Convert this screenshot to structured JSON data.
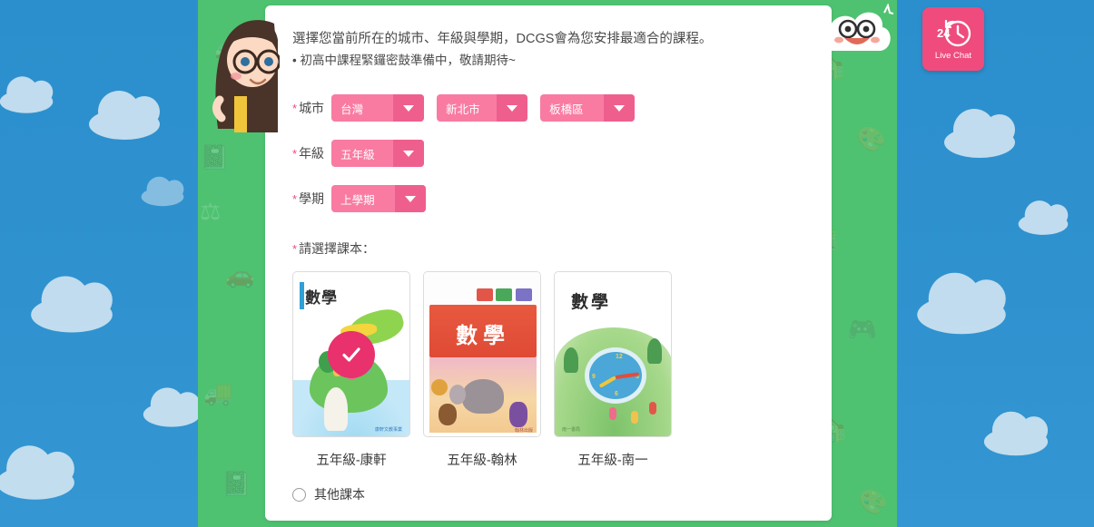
{
  "intro": {
    "line1": "選擇您當前所在的城市、年級與學期，DCGS會為您安排最適合的課程。",
    "line2": "• 初高中課程緊鑼密鼓準備中，敬請期待~"
  },
  "form": {
    "city": {
      "label": "城市",
      "required_mark": "*",
      "selects": [
        {
          "name": "country",
          "value": "台灣"
        },
        {
          "name": "city",
          "value": "新北市"
        },
        {
          "name": "district",
          "value": "板橋區"
        }
      ]
    },
    "grade": {
      "label": "年級",
      "required_mark": "*",
      "selects": [
        {
          "name": "grade",
          "value": "五年級"
        }
      ]
    },
    "term": {
      "label": "學期",
      "required_mark": "*",
      "selects": [
        {
          "name": "term",
          "value": "上學期"
        }
      ]
    }
  },
  "textbooks": {
    "label": "請選擇課本：",
    "required_mark": "*",
    "items": [
      {
        "caption": "五年級-康軒",
        "cover_title": "數學",
        "publisher_mark": "康軒文教事業",
        "selected": true
      },
      {
        "caption": "五年級-翰林",
        "cover_title": "數學",
        "publisher_mark": "翰林出版",
        "selected": false
      },
      {
        "caption": "五年級-南一",
        "cover_title": "數學",
        "publisher_mark": "南一書局",
        "selected": false
      }
    ],
    "other_option": {
      "label": "其他課本",
      "checked": false
    }
  },
  "live_chat": {
    "label": "Live Chat",
    "badge_number": "24"
  },
  "colors": {
    "sky_blue": "#2e90cc",
    "band_green": "#4ec271",
    "card_white": "#ffffff",
    "select_pink": "#f97ba2",
    "select_arrow_pink": "#ef5f8e",
    "accent_pink": "#ef4b7d",
    "check_badge_pink": "#e8316d",
    "text_dark": "#4a4a4a"
  },
  "icons": {
    "dropdown": "chevron-down-icon",
    "check": "check-icon",
    "clock": "clock-24h-icon",
    "radio": "radio-unchecked-icon"
  }
}
